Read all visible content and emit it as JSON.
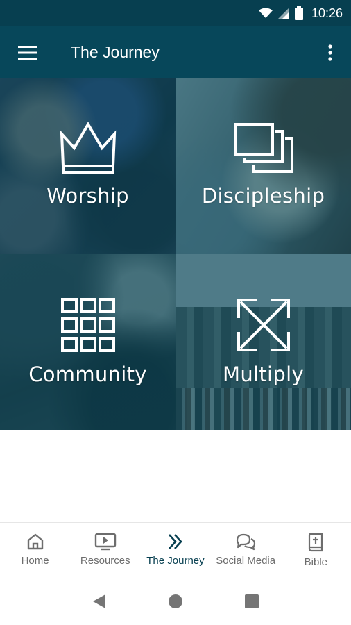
{
  "status_bar": {
    "time": "10:26"
  },
  "app_bar": {
    "title": "The Journey"
  },
  "tiles": [
    {
      "label": "Worship",
      "icon": "crown-icon"
    },
    {
      "label": "Discipleship",
      "icon": "stacked-squares-icon"
    },
    {
      "label": "Community",
      "icon": "grid-icon"
    },
    {
      "label": "Multiply",
      "icon": "expand-arrows-icon"
    }
  ],
  "bottom_nav": {
    "items": [
      {
        "label": "Home",
        "icon": "home-icon"
      },
      {
        "label": "Resources",
        "icon": "play-screen-icon"
      },
      {
        "label": "The Journey",
        "icon": "double-chevron-icon"
      },
      {
        "label": "Social Media",
        "icon": "chat-bubbles-icon"
      },
      {
        "label": "Bible",
        "icon": "bible-icon"
      }
    ],
    "active_index": 2
  },
  "colors": {
    "app_bar": "#07475a",
    "status_bar": "#073f50",
    "tile_overlay": "#06485c",
    "nav_active": "#073f50",
    "nav_inactive": "#6d6d6d"
  }
}
